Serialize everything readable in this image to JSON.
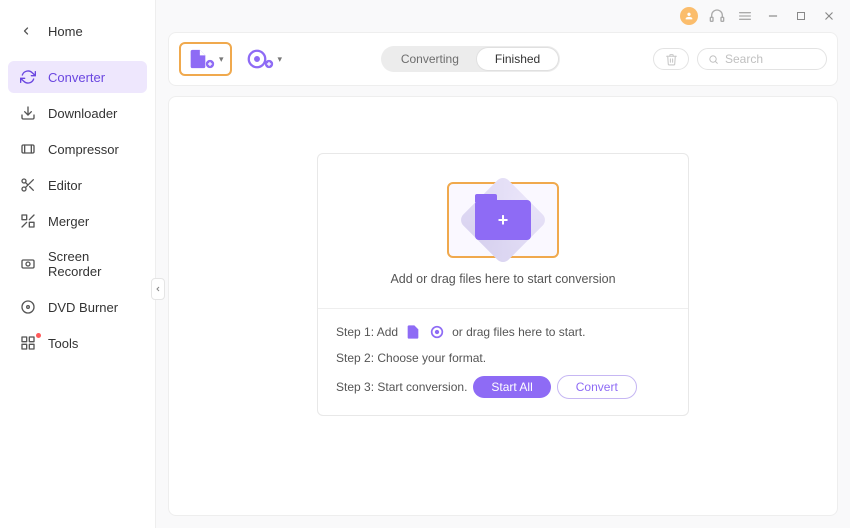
{
  "sidebar": {
    "home": "Home",
    "items": [
      {
        "label": "Converter"
      },
      {
        "label": "Downloader"
      },
      {
        "label": "Compressor"
      },
      {
        "label": "Editor"
      },
      {
        "label": "Merger"
      },
      {
        "label": "Screen Recorder"
      },
      {
        "label": "DVD Burner"
      },
      {
        "label": "Tools"
      }
    ]
  },
  "toolbar": {
    "tabs": {
      "converting": "Converting",
      "finished": "Finished"
    },
    "search_placeholder": "Search"
  },
  "drop": {
    "text": "Add or drag files here to start conversion"
  },
  "steps": {
    "s1a": "Step 1: Add",
    "s1b": "or drag files here to start.",
    "s2": "Step 2: Choose your format.",
    "s3": "Step 3: Start conversion.",
    "start_all": "Start All",
    "convert": "Convert"
  }
}
